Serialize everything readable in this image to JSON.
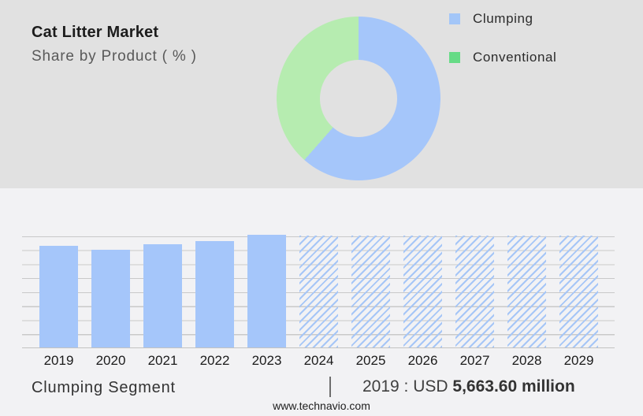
{
  "page_title": "Cat Litter Market infographic",
  "colors": {
    "top_background": "#e1e1e1",
    "bottom_background": "#f2f2f4",
    "series_blue": "#a5c6fa",
    "donut_green": "#b6ecb0",
    "legend_green": "#66db86",
    "legend_blue": "#a3c6f8",
    "hatch_blue": "#a6c6f7",
    "gridline": "#c9c9c9"
  },
  "header": {
    "title": "Cat Litter Market",
    "subtitle": "Share by Product ( % )"
  },
  "legend": {
    "items": [
      {
        "label": "Clumping",
        "color": "#a3c6f8",
        "swatch": "blue-square"
      },
      {
        "label": "Conventional",
        "color": "#66db86",
        "swatch": "green-square"
      }
    ]
  },
  "donut": {
    "segments": [
      {
        "label": "Clumping",
        "pct_estimated": 61.5,
        "color": "#a5c6fa"
      },
      {
        "label": "Conventional",
        "pct_estimated": 38.5,
        "color": "#b6ecb0"
      }
    ],
    "start_angle_deg": 0
  },
  "bar_chart": {
    "bars": [
      {
        "year": "2019",
        "rel": 91,
        "forecast": false
      },
      {
        "year": "2020",
        "rel": 87,
        "forecast": false
      },
      {
        "year": "2021",
        "rel": 92,
        "forecast": false
      },
      {
        "year": "2022",
        "rel": 95,
        "forecast": false
      },
      {
        "year": "2023",
        "rel": 101,
        "forecast": false
      },
      {
        "year": "2024",
        "rel": 100,
        "forecast": true
      },
      {
        "year": "2025",
        "rel": 100,
        "forecast": true
      },
      {
        "year": "2026",
        "rel": 100,
        "forecast": true
      },
      {
        "year": "2027",
        "rel": 100,
        "forecast": true
      },
      {
        "year": "2028",
        "rel": 100,
        "forecast": true
      },
      {
        "year": "2029",
        "rel": 100,
        "forecast": true
      }
    ]
  },
  "footer": {
    "segment_label": "Clumping Segment",
    "separator": "|",
    "value_prefix": "2019 : USD ",
    "value_bold": "5,663.60 million",
    "website": "www.technavio.com"
  },
  "chart_data": [
    {
      "type": "pie",
      "subtype": "donut",
      "title": "Cat Litter Market — Share by Product ( % )",
      "labels": [
        "Clumping",
        "Conventional"
      ],
      "values_estimated_pct": [
        61.5,
        38.5
      ],
      "colors": [
        "#a5c6fa",
        "#b6ecb0"
      ],
      "legend_position": "right",
      "notes": "no numeric labels shown; split estimated from arc angles; blue starts at 12 o'clock clockwise"
    },
    {
      "type": "bar",
      "categories": [
        "2019",
        "2020",
        "2021",
        "2022",
        "2023",
        "2024",
        "2025",
        "2026",
        "2027",
        "2028",
        "2029"
      ],
      "values_relative_pct_of_forecast_height": [
        91,
        87,
        92,
        95,
        101,
        100,
        100,
        100,
        100,
        100,
        100
      ],
      "forecast_years_hatched": [
        "2024",
        "2025",
        "2026",
        "2027",
        "2028",
        "2029"
      ],
      "title": "Clumping Segment",
      "xlabel": "",
      "ylabel": "",
      "grid": true,
      "notes": "y-axis unlabeled; 2024-2029 shown as diagonal-hatched forecast bars; annotation: 2019 : USD 5,663.60 million"
    }
  ]
}
